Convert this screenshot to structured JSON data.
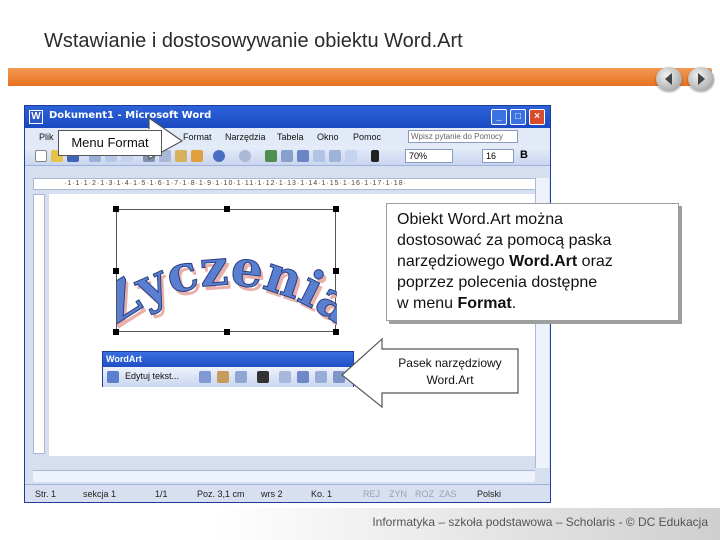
{
  "slide": {
    "title": "Wstawianie i dostosowywanie obiektu Word.Art",
    "footer": "Informatyka – szkoła podstawowa – Scholaris - © DC Edukacja",
    "nav": {
      "prev_icon": "chevron-left-icon",
      "next_icon": "chevron-right-icon"
    }
  },
  "word_window": {
    "title": "Dokument1 - Microsoft Word",
    "menu": [
      "Plik",
      "Format",
      "Narzędzia",
      "Tabela",
      "Okno",
      "Pomoc"
    ],
    "menu_visible": {
      "plik": "Plik",
      "format": "Format",
      "narzedzia": "Narzędzia",
      "tabela": "Tabela",
      "okno": "Okno",
      "pomoc": "Pomoc"
    },
    "ask_placeholder": "Wpisz pytanie do Pomocy",
    "zoom": "70%",
    "font_size": "16",
    "bold_label": "B",
    "ruler_text": "·1·1·1·2·1·3·1·4·1·5·1·6·1·7·1·8·1·9·1·10·1·11·1·12·1·13·1·14·1·15·1·16·1·17·1·18·",
    "status": {
      "page": "Str. 1",
      "section": "sekcja 1",
      "pages": "1/1",
      "position": "Poz. 3,1 cm",
      "line": "wrs 2",
      "column": "Ko. 1",
      "rej": "REJ",
      "zyn": "ZYN",
      "roz": "ROZ",
      "zas": "ZAS",
      "language": "Polski"
    }
  },
  "wordart": {
    "text": "Życzenia",
    "toolbar_title": "WordArt",
    "edit_button": "Edytuj tekst..."
  },
  "callouts": {
    "menu_format": "Menu Format",
    "toolbar_label_line1": "Pasek narzędziowy",
    "toolbar_label_line2": "Word.Art"
  },
  "info": {
    "line1": "Obiekt Word.Art można",
    "line2": "dostosować za pomocą paska",
    "line3_pre": "narzędziowego ",
    "line3_bold": "Word.Art",
    "line3_post": " oraz",
    "line4": "poprzez polecenia dostępne",
    "line5_pre": "w menu ",
    "line5_bold": "Format",
    "line5_post": "."
  },
  "colors": {
    "accent_orange": "#e8711f",
    "word_title_blue": "#1a49c2",
    "wordart_fill": "#5a7fd0",
    "wordart_shadow": "#e8b0a8"
  }
}
